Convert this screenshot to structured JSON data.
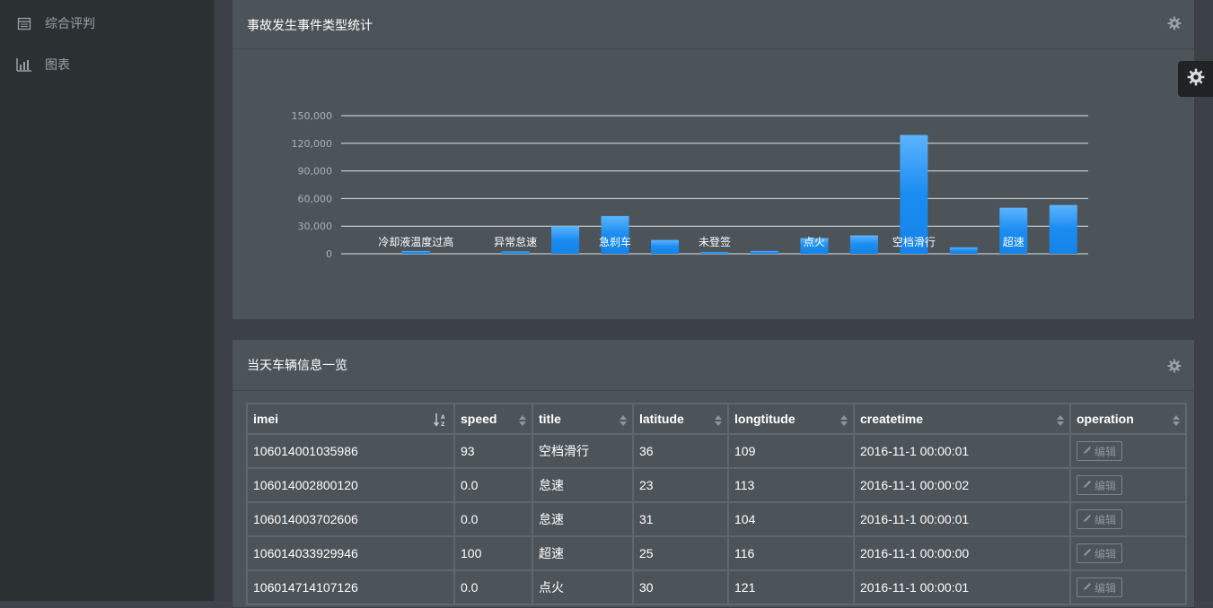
{
  "sidebar": {
    "items": [
      {
        "label": "综合评判",
        "icon": "calendar-icon"
      },
      {
        "label": "图表",
        "icon": "bar-chart-icon"
      }
    ]
  },
  "chart_panel": {
    "title": "事故发生事件类型统计",
    "icon": "gear-icon"
  },
  "chart_data": {
    "type": "bar",
    "title": "",
    "xlabel": "",
    "ylabel": "",
    "ylim": [
      0,
      150000
    ],
    "yticks": [
      "0",
      "30,000",
      "60,000",
      "90,000",
      "120,000",
      "150,000"
    ],
    "ytick_values": [
      0,
      30000,
      60000,
      90000,
      120000,
      150000
    ],
    "categories": [
      "",
      "冷却液温度过高",
      "",
      "异常怠速",
      "",
      "急刹车",
      "",
      "未登签",
      "",
      "点火",
      "",
      "空档滑行",
      "",
      "超速",
      ""
    ],
    "values": [
      0,
      3000,
      0,
      2500,
      30000,
      41000,
      15000,
      2000,
      3000,
      17000,
      20000,
      129000,
      7000,
      50000,
      53000
    ],
    "color": "#1a8cf0",
    "grid": true
  },
  "table_panel": {
    "title": "当天车辆信息一览",
    "icon": "gear-icon"
  },
  "table": {
    "columns": [
      "imei",
      "speed",
      "title",
      "latitude",
      "longtitude",
      "createtime",
      "operation"
    ],
    "edit_label": "编辑",
    "rows": [
      [
        "106014001035986",
        "93",
        "空档滑行",
        "36",
        "109",
        "2016-11-1 00:00:01"
      ],
      [
        "106014002800120",
        "0.0",
        "怠速",
        "23",
        "113",
        "2016-11-1 00:00:02"
      ],
      [
        "106014003702606",
        "0.0",
        "怠速",
        "31",
        "104",
        "2016-11-1 00:00:01"
      ],
      [
        "106014033929946",
        "100",
        "超速",
        "25",
        "116",
        "2016-11-1 00:00:00"
      ],
      [
        "106014714107126",
        "0.0",
        "点火",
        "30",
        "121",
        "2016-11-1 00:00:01"
      ]
    ]
  }
}
